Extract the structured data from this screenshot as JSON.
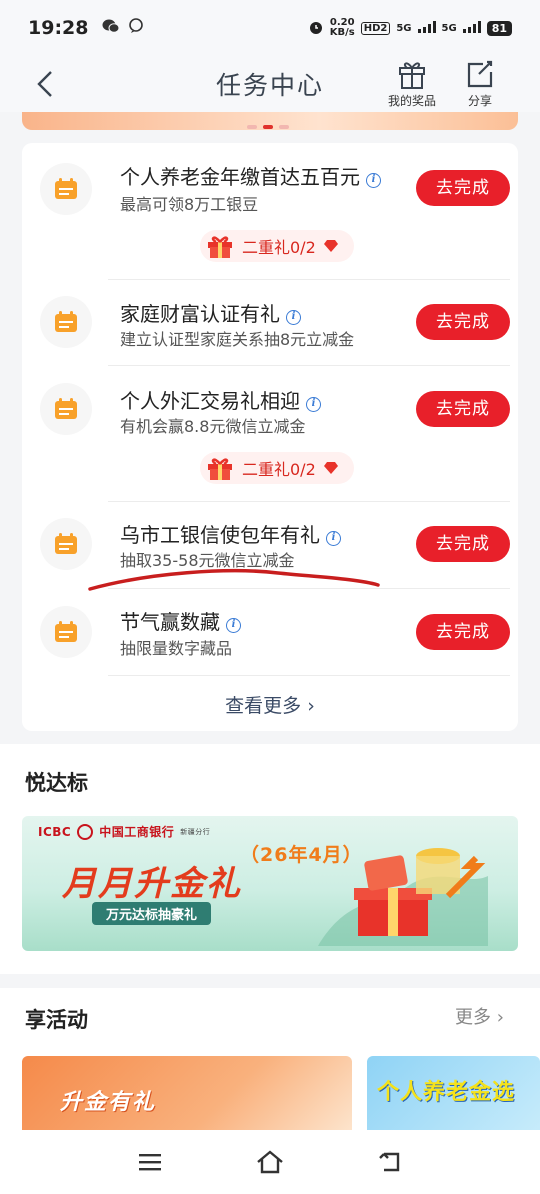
{
  "status_bar": {
    "time": "19:28",
    "net_speed": "0.20",
    "net_unit": "KB/s",
    "hd": "HD2",
    "sig1": "5G",
    "sig2": "5G",
    "battery": "81"
  },
  "header": {
    "title": "任务中心",
    "prize_label": "我的奖品",
    "share_label": "分享"
  },
  "tasks": [
    {
      "title": "个人养老金年缴首达五百元",
      "subtitle": "最高可领8万工银豆",
      "button": "去完成",
      "gift": "二重礼0/2"
    },
    {
      "title": "家庭财富认证有礼",
      "subtitle": "建立认证型家庭关系抽8元立减金",
      "button": "去完成"
    },
    {
      "title": "个人外汇交易礼相迎",
      "subtitle": "有机会赢8.8元微信立减金",
      "button": "去完成",
      "gift": "二重礼0/2"
    },
    {
      "title": "乌市工银信使包年有礼",
      "subtitle": "抽取35-58元微信立减金",
      "button": "去完成"
    },
    {
      "title": "节气赢数藏",
      "subtitle": "抽限量数字藏品",
      "button": "去完成"
    }
  ],
  "view_more": "查看更多",
  "section_yue": {
    "title": "悦达标",
    "banner": {
      "bank_en": "ICBC",
      "bank_cn": "中国工商银行",
      "branch": "新疆分行",
      "main": "月月升金礼",
      "date": "（26年4月）",
      "tag": "万元达标抽豪礼"
    }
  },
  "section_act": {
    "title": "享活动",
    "more": "更多",
    "cards": [
      {
        "title": "升金有礼"
      },
      {
        "title": "个人养老金选"
      }
    ]
  },
  "colors": {
    "accent": "#e8202a",
    "link": "#3b4b66",
    "annotation": "#c81e1e"
  }
}
